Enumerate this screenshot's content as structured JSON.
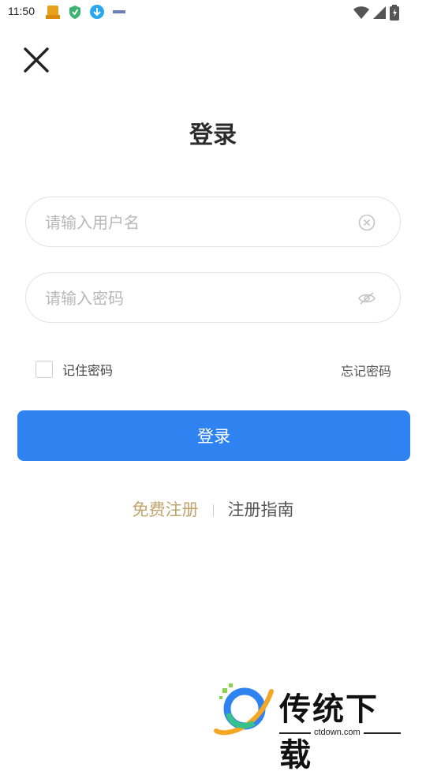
{
  "status_bar": {
    "time": "11:50"
  },
  "title": "登录",
  "username": {
    "placeholder": "请输入用户名",
    "value": ""
  },
  "password": {
    "placeholder": "请输入密码",
    "value": ""
  },
  "remember": {
    "label": "记住密码",
    "checked": false
  },
  "forgot_label": "忘记密码",
  "login_button": "登录",
  "links": {
    "register": "免费注册",
    "guide": "注册指南"
  },
  "watermark": {
    "name": "传统下载",
    "domain": "ctdown.com"
  },
  "colors": {
    "primary": "#2f83f0",
    "register_link": "#c1a46e",
    "text_dark": "#2b2b2b",
    "placeholder": "#b8b8b8"
  },
  "icons": [
    "close-icon",
    "clear-icon",
    "eye-hidden-icon",
    "wifi-icon",
    "signal-icon",
    "battery-icon"
  ]
}
